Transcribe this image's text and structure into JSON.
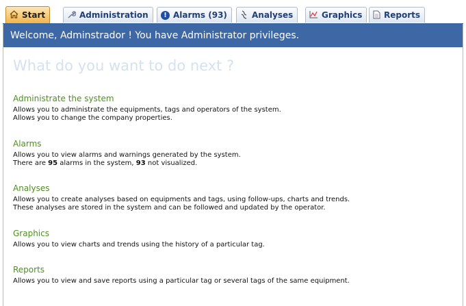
{
  "tabs": [
    {
      "label": "Start",
      "icon": "home-icon",
      "active": true
    },
    {
      "label": "Administration",
      "icon": "wrench-icon",
      "active": false
    },
    {
      "label": "Alarms (93)",
      "icon": "alarm-icon",
      "active": false
    },
    {
      "label": "Analyses",
      "icon": "analyses-icon",
      "active": false
    },
    {
      "label": "Graphics",
      "icon": "chart-icon",
      "active": false
    },
    {
      "label": "Reports",
      "icon": "document-icon",
      "active": false
    }
  ],
  "welcome": "Welcome, Adminstrador ! You have Administrator privileges.",
  "question": "What do you want to do next ?",
  "sections": {
    "admin": {
      "title": "Administrate the system",
      "line1": "Allows you to administrate the equipments, tags and operators of the system.",
      "line2": "Allows you to change the company properties."
    },
    "alarms": {
      "title": "Alarms",
      "line1": "Allows you to view alarms and warnings generated by the system.",
      "line2_prefix": "There are ",
      "total": "95",
      "line2_mid": " alarms in the system, ",
      "unseen": "93",
      "line2_suffix": " not visualized."
    },
    "analyses": {
      "title": "Analyses",
      "line1": "Allows you to create analyses based on equipments and tags, using follow-ups, charts and trends.",
      "line2": "These analyses are stored in the system and can be followed and updated by the operator."
    },
    "graphics": {
      "title": "Graphics",
      "line1": "Allows you to view charts and trends using the history of a particular tag."
    },
    "reports": {
      "title": "Reports",
      "line1": "Allows you to view and save reports using a particular tag or several tags of the same equipment."
    }
  },
  "colors": {
    "header_bar": "#3d67a5",
    "section_title": "#4f8f21",
    "question_text": "#d6e1ee",
    "active_tab": "#f3b34a"
  }
}
